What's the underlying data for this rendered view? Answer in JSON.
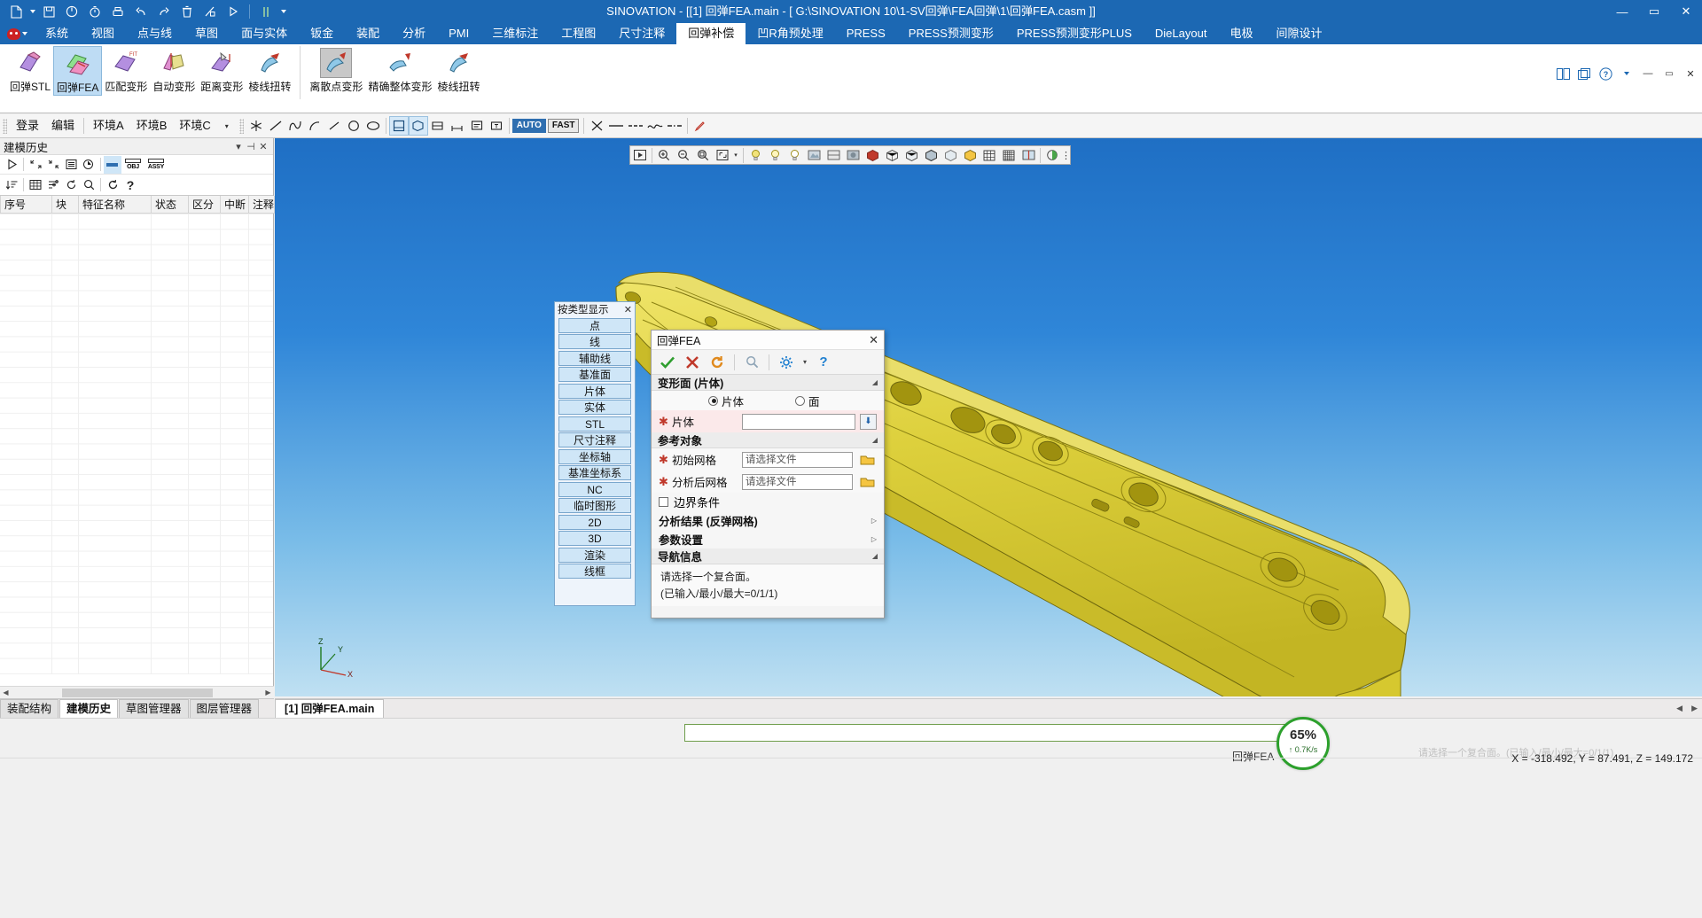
{
  "window": {
    "title": "SINOVATION - [[1] 回弹FEA.main - [ G:\\SINOVATION 10\\1-SV回弹\\FEA回弹\\1\\回弹FEA.casm ]]",
    "minimize": "—",
    "maximize": "▭",
    "close": "✕"
  },
  "quick_access": [
    {
      "name": "new-document-icon",
      "glyph": "🗋"
    },
    {
      "name": "save-icon",
      "glyph": "💾"
    },
    {
      "name": "power-icon",
      "glyph": "⏻"
    },
    {
      "name": "timer-icon",
      "glyph": "⏱"
    },
    {
      "name": "print-icon",
      "glyph": "🖨"
    },
    {
      "name": "undo-icon",
      "glyph": "↺"
    },
    {
      "name": "redo-icon",
      "glyph": "↻"
    },
    {
      "name": "delete-icon",
      "glyph": "🗑"
    },
    {
      "name": "measure-icon",
      "glyph": "📏"
    },
    {
      "name": "play-icon",
      "glyph": "▷"
    },
    {
      "name": "pause-icon",
      "glyph": "❙❙"
    }
  ],
  "menu": {
    "items": [
      {
        "label": "系统",
        "active": false
      },
      {
        "label": "视图",
        "active": false
      },
      {
        "label": "点与线",
        "active": false
      },
      {
        "label": "草图",
        "active": false
      },
      {
        "label": "面与实体",
        "active": false
      },
      {
        "label": "钣金",
        "active": false
      },
      {
        "label": "装配",
        "active": false
      },
      {
        "label": "分析",
        "active": false
      },
      {
        "label": "PMI",
        "active": false
      },
      {
        "label": "三维标注",
        "active": false
      },
      {
        "label": "工程图",
        "active": false
      },
      {
        "label": "尺寸注释",
        "active": false
      },
      {
        "label": "回弹补偿",
        "active": true
      },
      {
        "label": "凹R角预处理",
        "active": false
      },
      {
        "label": "PRESS",
        "active": false
      },
      {
        "label": "PRESS预测变形",
        "active": false
      },
      {
        "label": "PRESS预测变形PLUS",
        "active": false
      },
      {
        "label": "DieLayout",
        "active": false
      },
      {
        "label": "电极",
        "active": false
      },
      {
        "label": "间隙设计",
        "active": false
      }
    ]
  },
  "ribbon": {
    "group_title": "回弹补偿",
    "buttons": [
      {
        "label": "回弹STL",
        "selected": false,
        "boxed": false
      },
      {
        "label": "回弹FEA",
        "selected": true,
        "boxed": false
      },
      {
        "label": "匹配变形",
        "selected": false,
        "boxed": false
      },
      {
        "label": "自动变形",
        "selected": false,
        "boxed": false
      },
      {
        "label": "距离变形",
        "selected": false,
        "boxed": false
      },
      {
        "label": "棱线扭转",
        "selected": false,
        "boxed": false
      },
      {
        "label": "离散点变形",
        "selected": false,
        "boxed": true
      },
      {
        "label": "精确整体变形",
        "selected": false,
        "boxed": false
      },
      {
        "label": "棱线扭转",
        "selected": false,
        "boxed": false
      }
    ],
    "right_icons": [
      {
        "name": "window-tile-icon",
        "glyph": "▤"
      },
      {
        "name": "window-cascade-icon",
        "glyph": "▥"
      },
      {
        "name": "help-icon",
        "glyph": "?"
      },
      {
        "name": "ribbon-minimize-icon",
        "glyph": "—"
      },
      {
        "name": "ribbon-restore-icon",
        "glyph": "▭"
      },
      {
        "name": "ribbon-close-icon",
        "glyph": "✕"
      }
    ]
  },
  "toolbar2": {
    "text_items": [
      "登录",
      "编辑"
    ],
    "env_items": [
      "环境A",
      "环境B",
      "环境C"
    ],
    "mode_auto": "AUTO",
    "mode_fast": "FAST"
  },
  "left_panel": {
    "title": "建模历史",
    "tag_obj": "OBJ",
    "tag_assy": "ASSY",
    "columns": [
      "序号",
      "块",
      "特征名称",
      "状态",
      "区分",
      "中断",
      "注释"
    ],
    "rows": [],
    "tabs": [
      {
        "label": "装配结构",
        "active": false
      },
      {
        "label": "建模历史",
        "active": true
      },
      {
        "label": "草图管理器",
        "active": false
      },
      {
        "label": "图层管理器",
        "active": false
      }
    ]
  },
  "type_panel": {
    "title": "按类型显示",
    "close": "✕",
    "items": [
      "点",
      "线",
      "辅助线",
      "基准面",
      "片体",
      "实体",
      "STL",
      "尺寸注释",
      "坐标轴",
      "基准坐标系",
      "NC",
      "临时图形",
      "2D",
      "3D",
      "渲染",
      "线框"
    ]
  },
  "dialog": {
    "title": "回弹FEA",
    "close": "✕",
    "tools": [
      {
        "name": "confirm-check-icon",
        "glyph": "✔",
        "color": "#2f9e2f"
      },
      {
        "name": "cancel-cross-icon",
        "glyph": "✖",
        "color": "#c0392b"
      },
      {
        "name": "reset-undo-icon",
        "glyph": "↻",
        "color": "#e08a1e"
      },
      {
        "name": "zoom-search-icon",
        "glyph": "🔍",
        "color": "#7a95ad"
      },
      {
        "name": "settings-gear-icon",
        "glyph": "⚙",
        "color": "#1f7fd0"
      },
      {
        "name": "settings-dropdown-icon",
        "glyph": "▾",
        "color": "#444444"
      },
      {
        "name": "help-question-icon",
        "glyph": "?",
        "color": "#1f7fd0"
      }
    ],
    "section_deform": {
      "title": "变形面 (片体)",
      "radio_sheet": "片体",
      "radio_face": "面",
      "sheet_label": "片体",
      "sheet_value": "",
      "pick_glyph": "⬇"
    },
    "section_reference": {
      "title": "参考对象",
      "fields": [
        {
          "label": "初始网格",
          "value": "请选择文件",
          "required": true
        },
        {
          "label": "分析后网格",
          "value": "请选择文件",
          "required": true
        }
      ],
      "checkbox_label": "边界条件"
    },
    "collapsed_sections": [
      {
        "label": "分析结果 (反弹网格)"
      },
      {
        "label": "参数设置"
      }
    ],
    "section_nav": {
      "title": "导航信息",
      "line1": "请选择一个复合面。",
      "line2": "(已输入/最小/最大=0/1/1)"
    }
  },
  "viewport": {
    "toolbar_icons": [
      {
        "name": "play-view-icon",
        "glyph": "▷"
      },
      {
        "name": "zoom-in-icon",
        "glyph": "⊕"
      },
      {
        "name": "zoom-out-icon",
        "glyph": "⊖"
      },
      {
        "name": "zoom-window-icon",
        "glyph": "⊡"
      },
      {
        "name": "zoom-fit-icon",
        "glyph": "⊞"
      },
      {
        "name": "view-dropdown-icon",
        "glyph": "▾"
      },
      {
        "name": "light-bulb-1-icon",
        "glyph": "💡"
      },
      {
        "name": "light-bulb-2-icon",
        "glyph": "💡"
      },
      {
        "name": "render-mode-icon",
        "glyph": "◧"
      },
      {
        "name": "shade-mode-icon",
        "glyph": "◩"
      },
      {
        "name": "solid-red-icon",
        "glyph": "⬢"
      },
      {
        "name": "wireframe-icon",
        "glyph": "◯"
      },
      {
        "name": "hidden-line-icon",
        "glyph": "◎"
      },
      {
        "name": "shaded-edges-icon",
        "glyph": "◉"
      },
      {
        "name": "transparent-icon",
        "glyph": "◍"
      },
      {
        "name": "grid-icon",
        "glyph": "▦"
      },
      {
        "name": "grid-dense-icon",
        "glyph": "▩"
      },
      {
        "name": "section-icon",
        "glyph": "◪"
      },
      {
        "name": "color-picker-icon",
        "glyph": "🎨"
      },
      {
        "name": "more-icon",
        "glyph": "⋮"
      }
    ],
    "axis": {
      "x": "X",
      "y": "Y",
      "z": "Z"
    }
  },
  "doc_tabs": {
    "items": [
      {
        "label": "[1] 回弹FEA.main",
        "active": true
      }
    ],
    "nav_prev": "◀",
    "nav_next": "▶"
  },
  "status": {
    "progress_percent": 0,
    "badge_percent": "65%",
    "badge_speed": "↑ 0.7K/s",
    "left_label": "回弹FEA",
    "ghost_text": "请选择一个复合面。(已输入/最小/最大=0/1/1)",
    "coordinates": "X = -318.492, Y =   87.491, Z =  149.172"
  },
  "colors": {
    "title_blue": "#1c68b3",
    "accent_green": "#2ca02c",
    "required_red": "#c0392b",
    "highlight_blue": "#bedcf4",
    "part_yellow": "#e0d441"
  }
}
